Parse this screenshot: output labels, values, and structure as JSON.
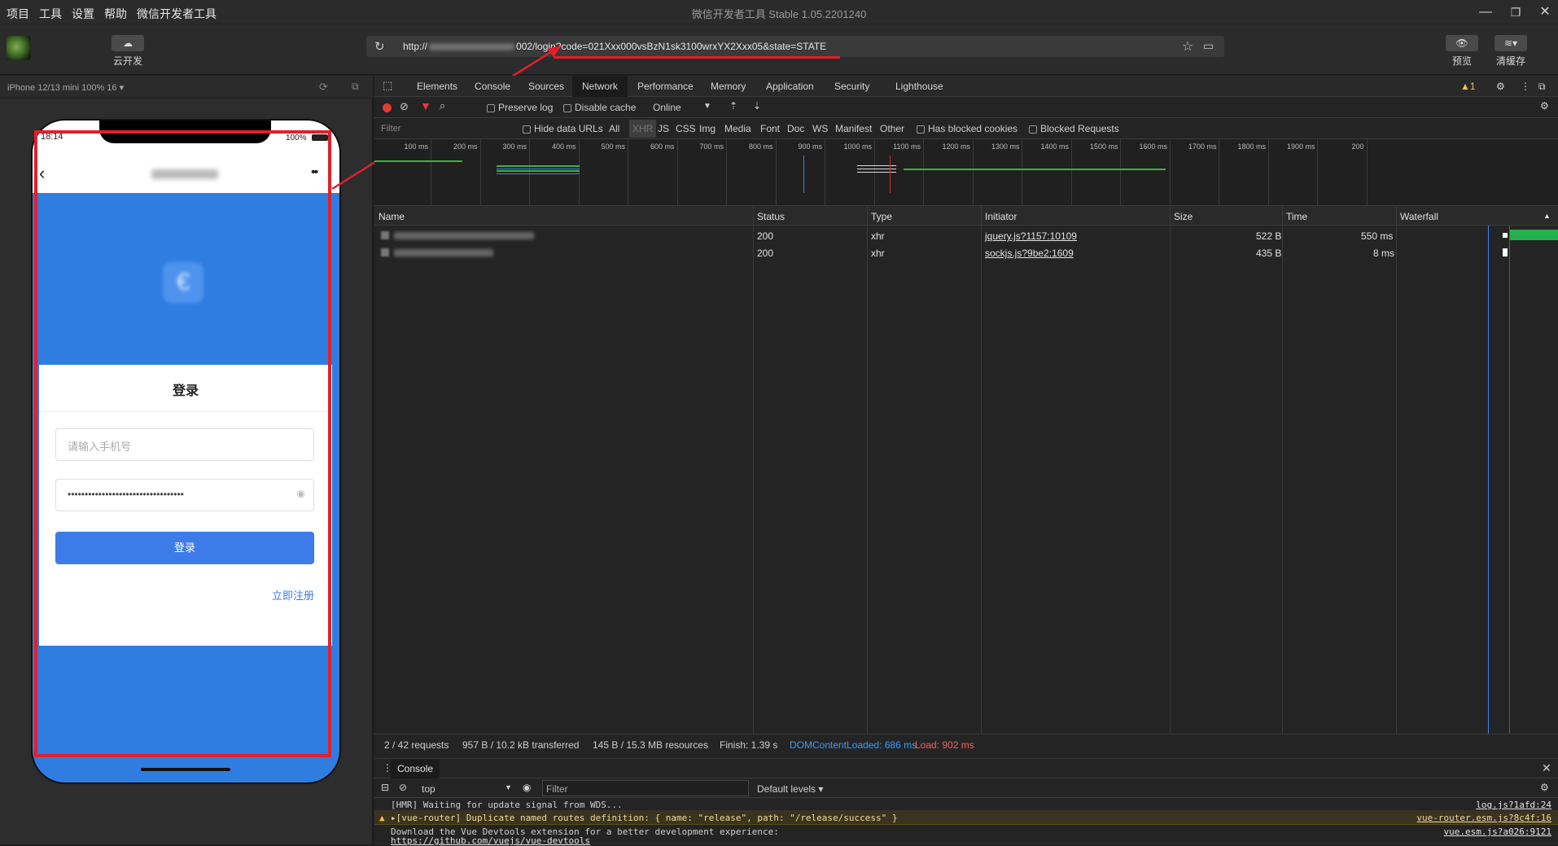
{
  "menu": [
    "项目",
    "工具",
    "设置",
    "帮助",
    "微信开发者工具"
  ],
  "window_title": "微信开发者工具 Stable 1.05.2201240",
  "toolbar": {
    "cloud_label": "云开发",
    "preview_label": "预览",
    "clearcache_label": "清缓存"
  },
  "url": {
    "prefix": "http://",
    "suffix": "002/login?code=021Xxx000vsBzN1sk3100wrxYX2Xxx05&state=STATE"
  },
  "simulator": {
    "device": "iPhone 12/13 mini 100% 16 ▾",
    "status_time": "18:14",
    "battery": "100%",
    "login_title": "登录",
    "phone_placeholder": "请输入手机号",
    "password_value": "••••••••••••••••••••••••••••••••••",
    "login_button": "登录",
    "register_link": "立即注册"
  },
  "devtools": {
    "tabs": [
      "Elements",
      "Console",
      "Sources",
      "Network",
      "Performance",
      "Memory",
      "Application",
      "Security",
      "Lighthouse"
    ],
    "active_tab": "Network",
    "warning_count": "▲1",
    "preserve_log": "Preserve log",
    "disable_cache": "Disable cache",
    "throttle": "Online",
    "filter_placeholder": "Filter",
    "hide_data_urls": "Hide data URLs",
    "types": [
      "All",
      "XHR",
      "JS",
      "CSS",
      "Img",
      "Media",
      "Font",
      "Doc",
      "WS",
      "Manifest",
      "Other"
    ],
    "has_blocked": "Has blocked cookies",
    "blocked_requests": "Blocked Requests",
    "timeline_ticks": [
      "100 ms",
      "200 ms",
      "300 ms",
      "400 ms",
      "500 ms",
      "600 ms",
      "700 ms",
      "800 ms",
      "900 ms",
      "1000 ms",
      "1100 ms",
      "1200 ms",
      "1300 ms",
      "1400 ms",
      "1500 ms",
      "1600 ms",
      "1700 ms",
      "1800 ms",
      "1900 ms",
      "200"
    ],
    "columns": [
      "Name",
      "Status",
      "Type",
      "Initiator",
      "Size",
      "Time",
      "Waterfall"
    ],
    "rows": [
      {
        "status": "200",
        "type": "xhr",
        "initiator": "jquery.js?1157:10109",
        "size": "522 B",
        "time": "550 ms"
      },
      {
        "status": "200",
        "type": "xhr",
        "initiator": "sockjs.js?9be2:1609",
        "size": "435 B",
        "time": "8 ms"
      }
    ],
    "status": {
      "requests": "2 / 42 requests",
      "transferred": "957 B / 10.2 kB transferred",
      "resources": "145 B / 15.3 MB resources",
      "finish": "Finish: 1.39 s",
      "domcontent": "DOMContentLoaded: 686 ms",
      "load": "Load: 902 ms"
    },
    "console": {
      "tab": "Console",
      "context": "top",
      "filter_placeholder": "Filter",
      "levels": "Default levels ▾",
      "lines": [
        {
          "text": "[HMR] Waiting for update signal from WDS...",
          "src": "log.js?1afd:24"
        },
        {
          "text": "▸[vue-router] Duplicate named routes definition: { name: \"release\", path: \"/release/success\" }",
          "src": "vue-router.esm.js?8c4f:16"
        },
        {
          "text": "Download the Vue Devtools extension for a better development experience:",
          "src": "vue.esm.js?a026:9121"
        },
        {
          "text": "https://github.com/vuejs/vue-devtools",
          "src": ""
        }
      ],
      "prompt": "›"
    }
  },
  "colors": {
    "accent": "#e1202b",
    "phone_blue": "#2f7de1",
    "button_blue": "#3d7be8",
    "link_blue": "#3b82f6"
  }
}
